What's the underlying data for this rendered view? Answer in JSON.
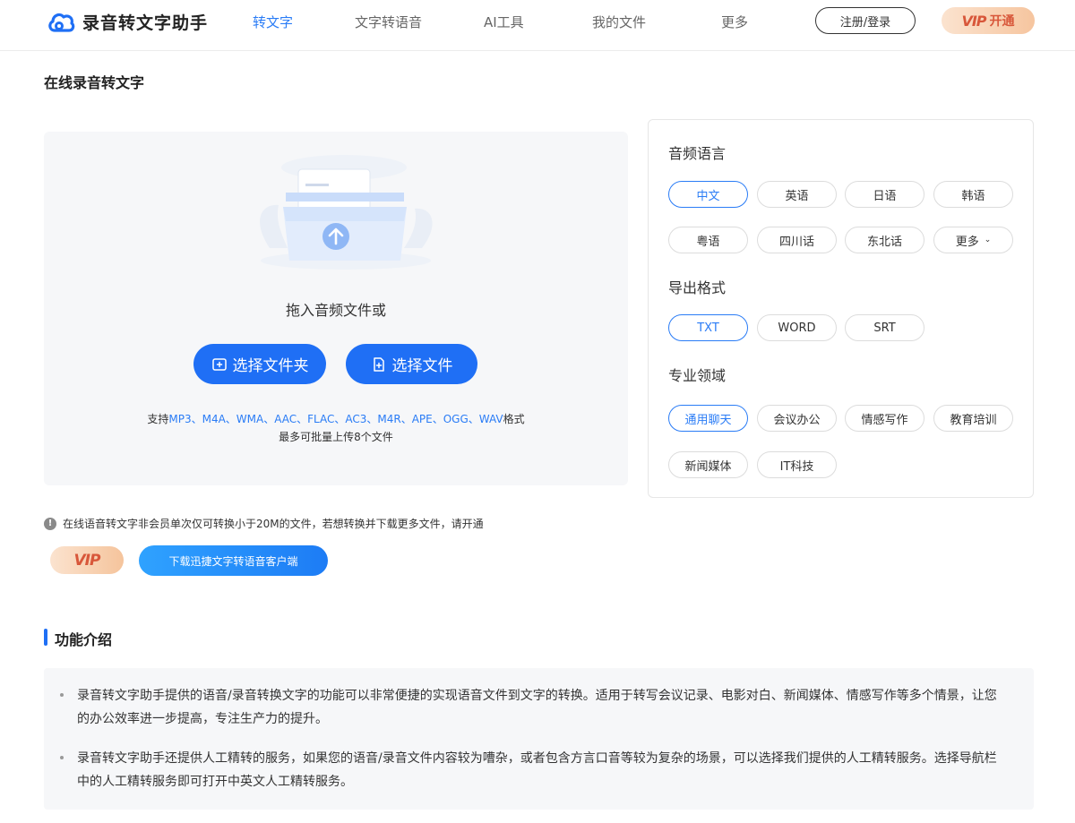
{
  "app": {
    "name": "录音转文字助手",
    "brand_color": "#1f6ff5"
  },
  "nav": {
    "items": [
      {
        "label": "转文字",
        "active": true
      },
      {
        "label": "文字转语音",
        "active": false
      },
      {
        "label": "AI工具",
        "active": false
      },
      {
        "label": "我的文件",
        "active": false
      },
      {
        "label": "更多",
        "active": false
      }
    ],
    "login_label": "注册/登录",
    "vip_badge": "VIP",
    "vip_open_label": "开通"
  },
  "page": {
    "title": "在线录音转文字"
  },
  "upload": {
    "drag_text": "拖入音频文件或",
    "select_folder_label": "选择文件夹",
    "select_file_label": "选择文件",
    "support_prefix": "支持",
    "support_formats": "MP3、M4A、WMA、AAC、FLAC、AC3、M4R、APE、OGG、WAV",
    "support_suffix": "格式",
    "batch_limit": "最多可批量上传8个文件"
  },
  "options": {
    "language": {
      "title": "音频语言",
      "items": [
        {
          "label": "中文",
          "selected": true
        },
        {
          "label": "英语",
          "selected": false
        },
        {
          "label": "日语",
          "selected": false
        },
        {
          "label": "韩语",
          "selected": false
        },
        {
          "label": "粤语",
          "selected": false
        },
        {
          "label": "四川话",
          "selected": false
        },
        {
          "label": "东北话",
          "selected": false
        },
        {
          "label": "更多",
          "selected": false
        }
      ]
    },
    "format": {
      "title": "导出格式",
      "items": [
        {
          "label": "TXT",
          "selected": true
        },
        {
          "label": "WORD",
          "selected": false
        },
        {
          "label": "SRT",
          "selected": false
        }
      ]
    },
    "domain": {
      "title": "专业领域",
      "items": [
        {
          "label": "通用聊天",
          "selected": true
        },
        {
          "label": "会议办公",
          "selected": false
        },
        {
          "label": "情感写作",
          "selected": false
        },
        {
          "label": "教育培训",
          "selected": false
        },
        {
          "label": "新闻媒体",
          "selected": false
        },
        {
          "label": "IT科技",
          "selected": false
        }
      ]
    }
  },
  "notice": {
    "text": "在线语音转文字非会员单次仅可转换小于20M的文件，若想转换并下载更多文件，请开通",
    "vip_badge": "VIP",
    "download_label": "下载迅捷文字转语音客户端"
  },
  "features": {
    "title": "功能介绍",
    "items": [
      "录音转文字助手提供的语音/录音转换文字的功能可以非常便捷的实现语音文件到文字的转换。适用于转写会议记录、电影对白、新闻媒体、情感写作等多个情景，让您的办公效率进一步提高，专注生产力的提升。",
      "录音转文字助手还提供人工精转的服务，如果您的语音/录音文件内容较为嘈杂，或者包含方言口音等较为复杂的场景，可以选择我们提供的人工精转服务。选择导航栏中的人工精转服务即可打开中英文人工精转服务。"
    ]
  }
}
